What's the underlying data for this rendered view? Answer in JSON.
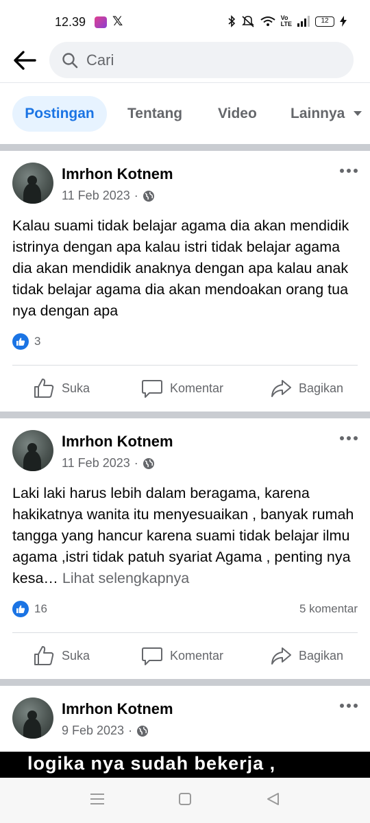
{
  "status_bar": {
    "time": "12.39",
    "app_icons": [
      "calendar-app-icon",
      "x-app-icon"
    ],
    "icons": [
      "bluetooth-icon",
      "mute-icon",
      "wifi-icon",
      "volte-icon",
      "signal-icon"
    ],
    "volte_label": "Vo\nLTE",
    "battery": "12"
  },
  "search": {
    "placeholder": "Cari"
  },
  "tabs": [
    {
      "label": "Postingan",
      "active": true
    },
    {
      "label": "Tentang"
    },
    {
      "label": "Video"
    },
    {
      "label": "Lainnya"
    }
  ],
  "colors": {
    "accent": "#1b74e4",
    "accent_bg": "#e7f3ff",
    "secondary_text": "#65676b",
    "separator": "#c9ccd1"
  },
  "posts": [
    {
      "author": "Imrhon Kotnem",
      "date": "11 Feb 2023",
      "separator": "·",
      "privacy_icon": "globe-icon",
      "text": "Kalau suami tidak belajar agama dia akan mendidik istrinya dengan apa kalau istri tidak belajar agama dia akan mendidik anaknya dengan apa kalau anak tidak belajar agama dia akan mendoakan orang tua nya dengan apa",
      "see_more": "",
      "reactions": "3",
      "comments": "",
      "actions": {
        "like": "Suka",
        "comment": "Komentar",
        "share": "Bagikan"
      }
    },
    {
      "author": "Imrhon Kotnem",
      "date": "11 Feb 2023",
      "separator": "·",
      "privacy_icon": "globe-icon",
      "text": "Laki laki harus lebih dalam beragama, karena hakikatnya wanita itu menyesuaikan , banyak rumah tangga yang hancur karena suami tidak belajar ilmu agama ,istri tidak patuh syariat Agama , penting nya kesa…",
      "see_more": "Lihat selengkapnya",
      "reactions": "16",
      "comments": "5 komentar",
      "actions": {
        "like": "Suka",
        "comment": "Komentar",
        "share": "Bagikan"
      }
    },
    {
      "author": "Imrhon Kotnem",
      "date": "9 Feb 2023",
      "separator": "·",
      "privacy_icon": "globe-icon",
      "video_caption": "logika nya sudah bekerja ,"
    }
  ],
  "nav_bar": [
    "menu-icon",
    "home-icon",
    "back-icon"
  ]
}
